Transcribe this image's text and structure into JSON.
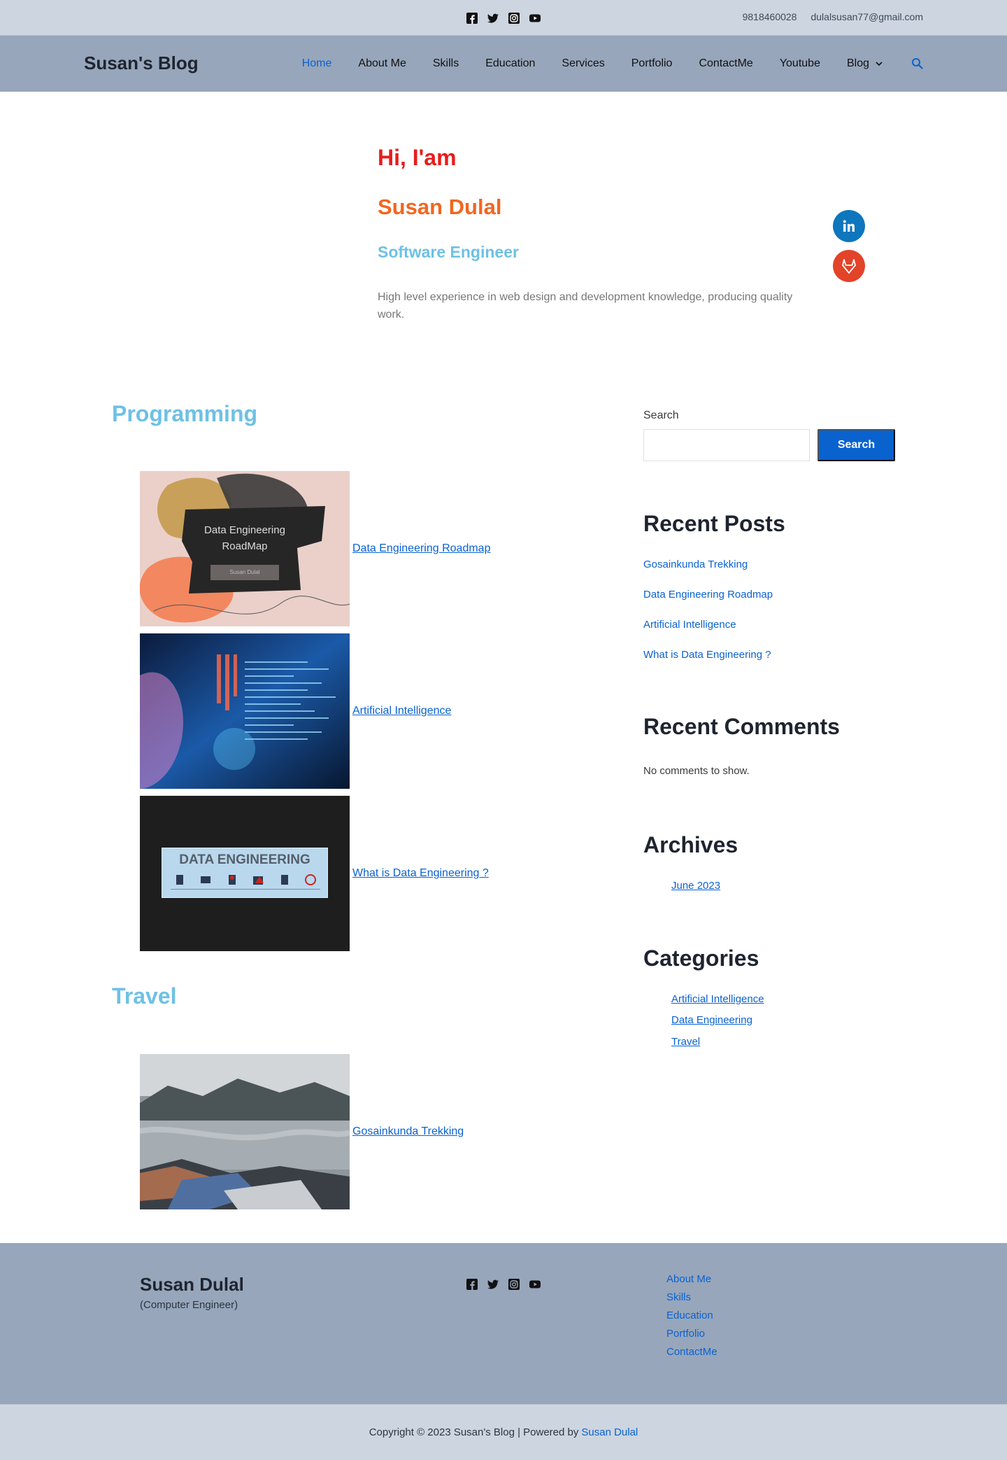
{
  "topbar": {
    "socials": [
      "facebook-icon",
      "twitter-icon",
      "instagram-icon",
      "youtube-icon"
    ],
    "phone": "9818460028",
    "email": "dulalsusan77@gmail.com"
  },
  "header": {
    "logo": "Susan's Blog",
    "nav": [
      {
        "label": "Home",
        "active": true
      },
      {
        "label": "About Me"
      },
      {
        "label": "Skills"
      },
      {
        "label": "Education"
      },
      {
        "label": "Services"
      },
      {
        "label": "Portfolio"
      },
      {
        "label": "ContactMe"
      },
      {
        "label": "Youtube"
      },
      {
        "label": "Blog",
        "dropdown": true
      }
    ],
    "search_icon": "search-icon"
  },
  "hero": {
    "greeting": "Hi, I'am",
    "name": "Susan Dulal",
    "role": "Software Engineer",
    "description": "High level experience in web design and development knowledge, producing quality work.",
    "side_icons": [
      "linkedin-icon",
      "gitlab-icon"
    ]
  },
  "sections": [
    {
      "title": "Programming",
      "posts": [
        {
          "title": "Data Engineering Roadmap",
          "thumb_text": [
            "Data Engineering",
            "RoadMap",
            "Susan Dulal"
          ]
        },
        {
          "title": "Artificial Intelligence"
        },
        {
          "title": "What is Data Engineering ?",
          "thumb_text": [
            "DATA ENGINEERING"
          ]
        }
      ]
    },
    {
      "title": "Travel",
      "posts": [
        {
          "title": "Gosainkunda Trekking"
        }
      ]
    }
  ],
  "sidebar": {
    "search_label": "Search",
    "search_button": "Search",
    "recent_posts_title": "Recent Posts",
    "recent_posts": [
      "Gosainkunda Trekking",
      "Data Engineering Roadmap",
      "Artificial Intelligence",
      "What is Data Engineering ?"
    ],
    "recent_comments_title": "Recent Comments",
    "no_comments": "No comments to show.",
    "archives_title": "Archives",
    "archives": [
      "June 2023"
    ],
    "categories_title": "Categories",
    "categories": [
      "Artificial Intelligence",
      "Data Engineering",
      "Travel"
    ]
  },
  "footer": {
    "name": "Susan Dulal",
    "subtitle": "(Computer Engineer)",
    "links": [
      "About Me",
      "Skills",
      "Education",
      "Portfolio",
      "ContactMe"
    ],
    "copyright_text": "Copyright © 2023 Susan's Blog | Powered by",
    "copyright_author": "Susan Dulal"
  },
  "colors": {
    "accent_blue": "#0a62cf",
    "light_blue": "#6ec1e4",
    "red": "#e81d1d",
    "orange": "#f2661f"
  }
}
